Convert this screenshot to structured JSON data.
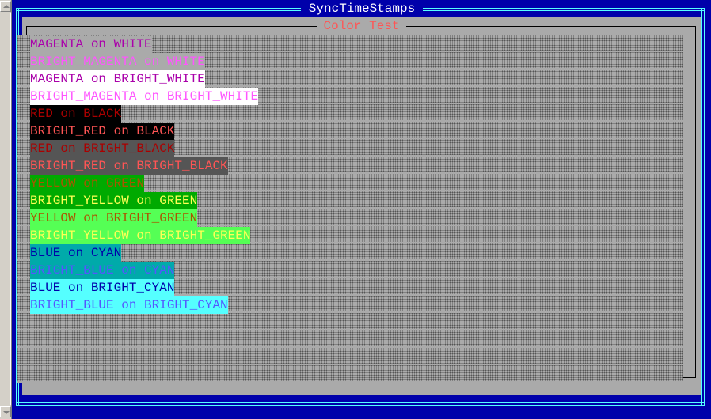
{
  "window": {
    "title": "SyncTimeStamps"
  },
  "panel": {
    "title": "Color Test"
  },
  "colors": {
    "window_bg": "#0000aa",
    "border": "#55ffff",
    "panel_bg": "#aaaaaa",
    "panel_title": "#ff5555"
  },
  "rows": [
    {
      "text": "MAGENTA on WHITE",
      "fg": "#aa00aa",
      "bg": "#aaaaaa"
    },
    {
      "text": "BRIGHT_MAGENTA on WHITE",
      "fg": "#ff55ff",
      "bg": "#aaaaaa"
    },
    {
      "text": "MAGENTA on BRIGHT_WHITE",
      "fg": "#aa00aa",
      "bg": "#ffffff"
    },
    {
      "text": "BRIGHT_MAGENTA on BRIGHT_WHITE",
      "fg": "#ff55ff",
      "bg": "#ffffff"
    },
    {
      "text": "RED on BLACK",
      "fg": "#aa0000",
      "bg": "#000000"
    },
    {
      "text": "BRIGHT_RED on BLACK",
      "fg": "#ff5555",
      "bg": "#000000"
    },
    {
      "text": "RED on BRIGHT_BLACK",
      "fg": "#aa0000",
      "bg": "#555555"
    },
    {
      "text": "BRIGHT_RED on BRIGHT_BLACK",
      "fg": "#ff5555",
      "bg": "#555555"
    },
    {
      "text": "YELLOW on GREEN",
      "fg": "#aa5500",
      "bg": "#00aa00"
    },
    {
      "text": "BRIGHT_YELLOW on GREEN",
      "fg": "#ffff55",
      "bg": "#00aa00"
    },
    {
      "text": "YELLOW on BRIGHT_GREEN",
      "fg": "#aa5500",
      "bg": "#55ff55"
    },
    {
      "text": "BRIGHT_YELLOW on BRIGHT_GREEN",
      "fg": "#ffff55",
      "bg": "#55ff55"
    },
    {
      "text": "BLUE on CYAN",
      "fg": "#0000aa",
      "bg": "#00aaaa"
    },
    {
      "text": "BRIGHT_BLUE on CYAN",
      "fg": "#5555ff",
      "bg": "#00aaaa"
    },
    {
      "text": "BLUE on BRIGHT_CYAN",
      "fg": "#0000aa",
      "bg": "#55ffff"
    },
    {
      "text": "BRIGHT_BLUE on BRIGHT_CYAN",
      "fg": "#5555ff",
      "bg": "#55ffff"
    }
  ]
}
